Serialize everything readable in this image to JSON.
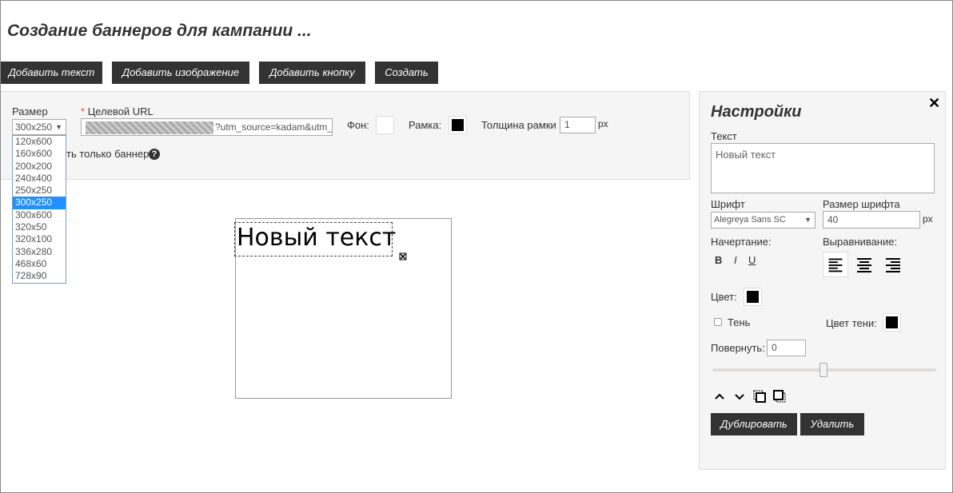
{
  "page": {
    "title": "Создание баннеров для кампании ..."
  },
  "toolbar": {
    "add_text": "Добавить текст",
    "add_image": "Добавить изображение",
    "add_button": "Добавить кнопку",
    "create": "Создать"
  },
  "form": {
    "size_label": "Размер",
    "size_value": "300x250",
    "size_options": [
      "120x600",
      "160x600",
      "200x200",
      "240x400",
      "250x250",
      "300x250",
      "300x600",
      "320x50",
      "320x100",
      "336x280",
      "468x60",
      "728x90"
    ],
    "url_required_mark": "*",
    "url_label": "Целевой URL",
    "url_value": "?utm_source=kadam&utm_m",
    "bg_label": "Фон:",
    "bg_color": "#ffffff",
    "border_label": "Рамка:",
    "border_color": "#000000",
    "border_width_label": "Толщина рамки",
    "border_width_value": "1",
    "border_width_unit": "px",
    "banner_only_label": "ть только баннер",
    "help_glyph": "?"
  },
  "canvas": {
    "text": "Новый текст"
  },
  "settings": {
    "title": "Настройки",
    "close_glyph": "✕",
    "text_label": "Текст",
    "text_value": "Новый текст",
    "font_label": "Шрифт",
    "font_value": "Alegreya Sans SC",
    "font_size_label": "Размер шрифта",
    "font_size_value": "40",
    "font_size_unit": "px",
    "style_label": "Начертание:",
    "bold": "B",
    "italic": "I",
    "underline": "U",
    "align_label": "Выравнивание:",
    "align_active": "left",
    "color_label": "Цвет:",
    "color_value": "#000000",
    "shadow_label": "Тень",
    "shadow_checked": false,
    "shadow_color_label": "Цвет тени:",
    "shadow_color_value": "#000000",
    "rotate_label": "Повернуть:",
    "rotate_value": "0",
    "rotate_slider_fraction": 0.5,
    "duplicate": "Дублировать",
    "delete": "Удалить",
    "icons": [
      "chevron-up-icon",
      "chevron-down-icon",
      "bring-front-icon",
      "send-back-icon"
    ]
  }
}
